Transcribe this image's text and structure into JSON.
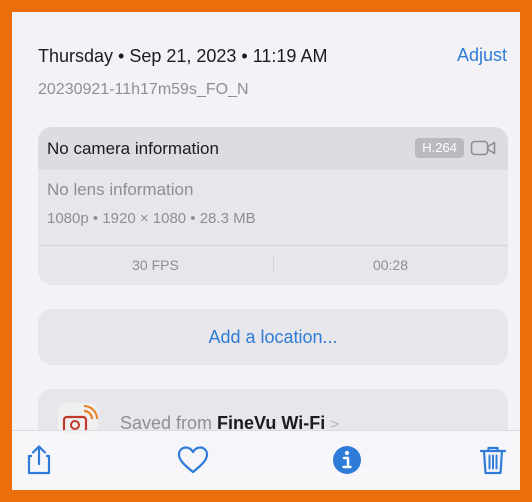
{
  "header": {
    "date_line": "Thursday • Sep 21, 2023 • 11:19 AM",
    "adjust_label": "Adjust",
    "filename": "20230921-11h17m59s_FO_N"
  },
  "media_info": {
    "camera": "No camera information",
    "codec_badge": "H.264",
    "lens": "No lens information",
    "specs": "1080p • 1920 × 1080 • 28.3 MB",
    "fps": "30 FPS",
    "duration": "00:28",
    "icons": [
      "video-camera-icon"
    ]
  },
  "location": {
    "add_label": "Add a location..."
  },
  "source": {
    "prefix": "Saved from ",
    "app_name": "FineVu Wi-Fi",
    "chevron": ">"
  },
  "toolbar": {
    "icons": [
      "share-icon",
      "heart-icon",
      "info-icon",
      "trash-icon"
    ]
  },
  "colors": {
    "accent": "#2f7cd8",
    "frame": "#ea6e0c"
  }
}
